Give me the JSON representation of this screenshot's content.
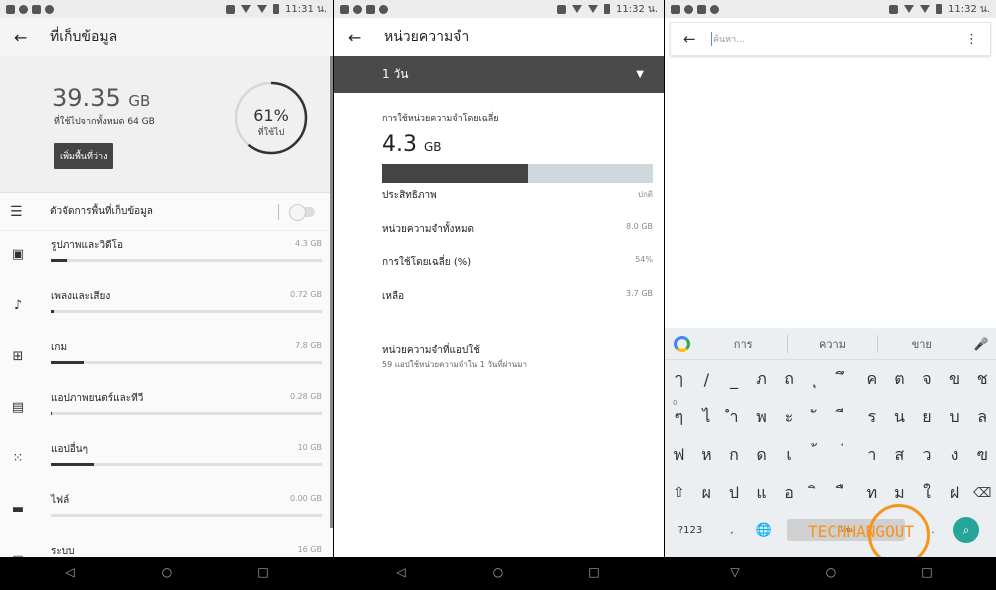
{
  "status": {
    "time_1": "11:31 น.",
    "time_2": "11:32 น.",
    "time_3": "11:32 น."
  },
  "storage": {
    "title": "ที่เก็บข้อมูล",
    "used_value": "39.35",
    "used_unit": "GB",
    "used_sub": "ที่ใช้ไปจากทั้งหมด 64 GB",
    "free_button": "เพิ่มพื้นที่ว่าง",
    "percent_label": "61%",
    "percent_value": 61,
    "percent_sub": "ที่ใช้ไป",
    "manager_label": "ตัวจัดการพื้นที่เก็บข้อมูล",
    "categories": [
      {
        "name": "รูปภาพและวิดีโอ",
        "size": "4.3 GB",
        "icon": "image-icon",
        "fraction": 0.06
      },
      {
        "name": "เพลงและเสียง",
        "size": "0.72 GB",
        "icon": "music-note-icon",
        "fraction": 0.01
      },
      {
        "name": "เกม",
        "size": "7.8 GB",
        "icon": "gamepad-icon",
        "fraction": 0.12
      },
      {
        "name": "แอปภาพยนตร์และทีวี",
        "size": "0.28 GB",
        "icon": "film-icon",
        "fraction": 0.005
      },
      {
        "name": "แอปอื่นๆ",
        "size": "10 GB",
        "icon": "apps-grid-icon",
        "fraction": 0.16
      },
      {
        "name": "ไฟล์",
        "size": "0.00 GB",
        "icon": "folder-icon",
        "fraction": 0.0
      },
      {
        "name": "ระบบ",
        "size": "16 GB",
        "icon": "system-icon",
        "fraction": 0.25
      }
    ]
  },
  "memory": {
    "title": "หน่วยความจำ",
    "period": "1 วัน",
    "avg_label": "การใช้หน่วยความจำโดยเฉลี่ย",
    "avg_value": "4.3",
    "avg_unit": "GB",
    "bar_fraction": 0.54,
    "rows": [
      {
        "label": "ประสิทธิภาพ",
        "value": "ปกติ"
      },
      {
        "label": "หน่วยความจำทั้งหมด",
        "value": "8.0 GB"
      },
      {
        "label": "การใช้โดยเฉลี่ย (%)",
        "value": "54%"
      },
      {
        "label": "เหลือ",
        "value": "3.7 GB"
      }
    ],
    "apps_title": "หน่วยความจำที่แอปใช้",
    "apps_sub": "59 แอปใช้หน่วยความจำใน 1 วันที่ผ่านมา"
  },
  "search": {
    "placeholder": "ค้นหา..."
  },
  "keyboard": {
    "suggestions": [
      "การ",
      "ความ",
      "ขาย"
    ],
    "row1": [
      "ๅ",
      "/",
      "_",
      "ภ",
      "ถ",
      "ุ",
      "ึ",
      "ค",
      "ต",
      "จ",
      "ข",
      "ช"
    ],
    "row2": [
      "ๆ",
      "ไ",
      "ำ",
      "พ",
      "ะ",
      "ั",
      "ี",
      "ร",
      "น",
      "ย",
      "บ",
      "ล"
    ],
    "row3": [
      "ฟ",
      "ห",
      "ก",
      "ด",
      "เ",
      "้",
      "่",
      "า",
      "ส",
      "ว",
      "ง",
      "ฃ"
    ],
    "row4": [
      "ผ",
      "ป",
      "แ",
      "อ",
      "ิ",
      "ื",
      "ท",
      "ม",
      "ใ",
      "ฝ"
    ],
    "row2_hint": "0",
    "key_123": "?123",
    "space_label": "ไทย"
  },
  "watermark": {
    "text": "TECHHANGOUT"
  }
}
